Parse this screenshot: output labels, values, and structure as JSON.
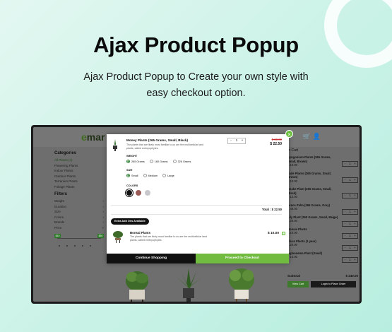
{
  "hero": {
    "title": "Ajax Product Popup",
    "subtitle_line1": "Ajax Product Popup to Create your own style with",
    "subtitle_line2": "easy checkout option."
  },
  "site": {
    "logo_e": "e",
    "logo_rest": "mar"
  },
  "sidebar": {
    "categories_title": "Categories",
    "categories": [
      "All Plants (4)",
      "Flowering Plants",
      "Indoor Plants",
      "Outdoor Plants",
      "Terrarium Plants",
      "Foliage Plants"
    ],
    "filters_title": "Filters",
    "filters": [
      "Weight",
      "Duration",
      "Size",
      "Colors",
      "Brands",
      "Price"
    ],
    "price_min": "$10",
    "price_max": "$50"
  },
  "cart": {
    "title": "In Cart",
    "items": [
      {
        "name": "Syngonium Plants (265 Grams, Small, Brown)",
        "price": "$ 10.00"
      },
      {
        "name": "Jade Plants (265 Grams, Small, Brown)",
        "price": "$ 10.00"
      },
      {
        "name": "Snake Plant (265 Grams, Small, Black)",
        "price": "$ 12.00"
      },
      {
        "name": "Areca Palm (265 Grams, Gray)",
        "price": "$ 48.00"
      },
      {
        "name": "Lily Plant (265 Grams, Small, Beige)",
        "price": "$ 20.00"
      },
      {
        "name": "Bonsai Plants",
        "price": "$ 10.00"
      },
      {
        "name": "Ficus Plants (1 year)",
        "price": "$ 20.00"
      },
      {
        "name": "Aglaonema Plant (Small)",
        "price": "$ 10.00"
      }
    ],
    "stepper_minus": "-",
    "stepper_qty": "1",
    "stepper_plus": "+",
    "subtotal_label": "Subtotal",
    "subtotal_value": "$ 240.00",
    "view_cart": "View Cart",
    "login": "Login to Place Order"
  },
  "popup": {
    "product_name": "Money Plants (265 Grams, Small, Black)",
    "product_desc": "The plants that are likely most familiar to us are the multicellular land plants, called embryophytes.",
    "qty_minus": "-",
    "qty": "1",
    "qty_plus": "+",
    "old_price": "$ 30.00",
    "price": "$ 22.50",
    "weight_label": "WEIGHT",
    "weights": [
      "265 Grams",
      "160 Grams",
      "326 Grams"
    ],
    "size_label": "SIZE",
    "sizes": [
      "Small",
      "Medium",
      "Large"
    ],
    "colors_label": "COLORS",
    "total": "Total : $ 22.50",
    "extra_label": "Extra Add Ons Available",
    "addon_name": "Bonsai Plants",
    "addon_desc": "The plants that are likely most familiar to us are the multicellular land plants, called embryophytes.",
    "addon_price": "$ 10.00",
    "continue_label": "Continue Shopping",
    "checkout_label": "Proceed to Checkout"
  },
  "colors": {
    "brand_green": "#71bb41",
    "swatch_black": "#111111",
    "swatch_brown": "#9a5a55",
    "swatch_gray": "#c8c8cc"
  }
}
